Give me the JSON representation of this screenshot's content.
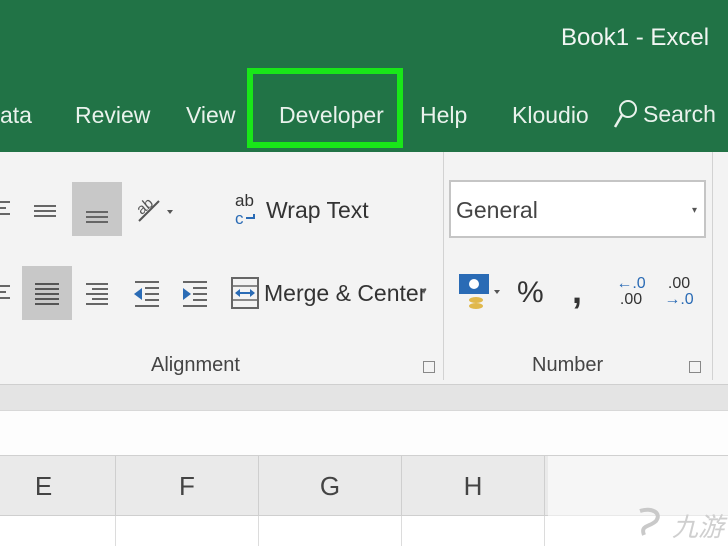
{
  "window": {
    "title": "Book1  -  Excel"
  },
  "tabs": [
    {
      "label": "ata"
    },
    {
      "label": "Review"
    },
    {
      "label": "View"
    },
    {
      "label": "Developer"
    },
    {
      "label": "Help"
    },
    {
      "label": "Kloudio"
    }
  ],
  "search": {
    "label": "Search",
    "icon": "search-icon"
  },
  "alignment": {
    "wrap_text_icon": "ab c",
    "wrap_text": "Wrap Text",
    "merge_center": "Merge & Center",
    "group_label": "Alignment"
  },
  "number": {
    "format_value": "General",
    "percent": "%",
    "comma": ",",
    "inc_decimal_top": "←.0",
    "inc_decimal_bottom": ".00",
    "dec_decimal_top": ".00",
    "dec_decimal_bottom": "→.0",
    "group_label": "Number"
  },
  "columns": [
    "E",
    "F",
    "G",
    "H"
  ],
  "watermark": {
    "text": "九游"
  },
  "colors": {
    "title_bar": "#217346",
    "highlight": "#19e619",
    "ribbon": "#f3f3f3"
  }
}
